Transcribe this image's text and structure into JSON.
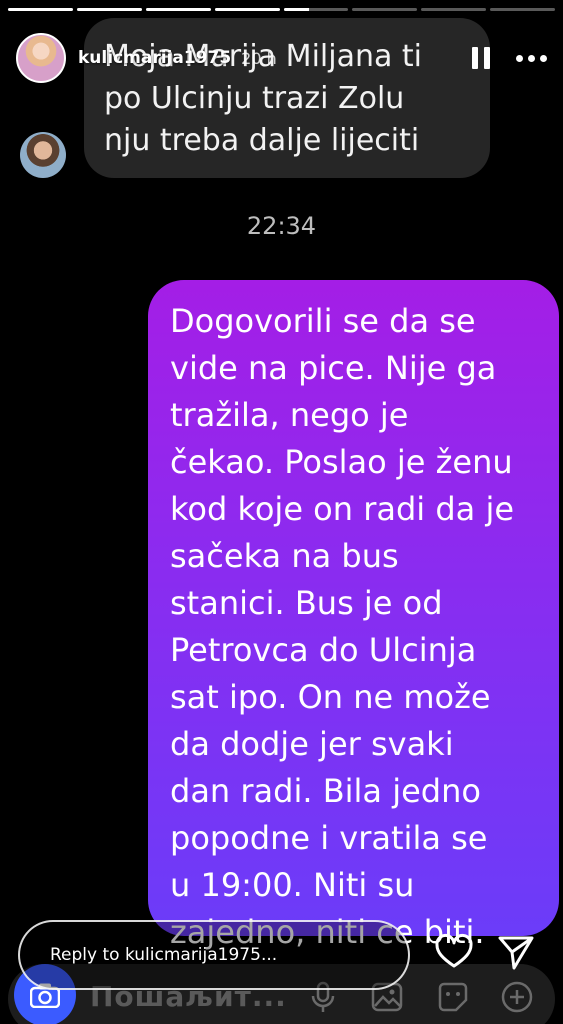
{
  "story": {
    "username": "kulicmarija1975",
    "time_ago": "20 h",
    "progress": [
      1,
      1,
      1,
      1,
      0.4,
      0,
      0,
      0
    ]
  },
  "chat": {
    "incoming_text": "Moja Marija Miljana ti\npo Ulcinju trazi Zolu\nnju treba dalje lijeciti",
    "timestamp": "22:34",
    "outgoing_text": "Dogovorili se da se\nvide na pice. Nije ga\ntražila, nego je\nčekao. Poslao je ženu\nkod koje on radi da je\nsačeka na bus\nstanici. Bus je od\nPetrovca do Ulcinja\nsat ipo. On ne može\nda dodje jer svaki\ndan radi. Bila jedno\npopodne i vratila se\nu 19:00. Niti su\nzajedno, niti ce biti."
  },
  "reply": {
    "placeholder": "Reply to kulicmarija1975..."
  },
  "composer": {
    "placeholder": "Пошаљит..."
  },
  "icons": {
    "pause": "pause-icon",
    "more": "more-icon",
    "heart": "heart-icon",
    "send": "send-icon",
    "camera": "camera-icon",
    "mic": "mic-icon",
    "gallery": "gallery-icon",
    "sticker": "sticker-icon",
    "plus": "plus-icon"
  },
  "colors": {
    "bubble_top": "#a41ee6",
    "bubble_bottom": "#6b3cf9",
    "incoming_bg": "#262626",
    "camera": "#3b5bff"
  }
}
